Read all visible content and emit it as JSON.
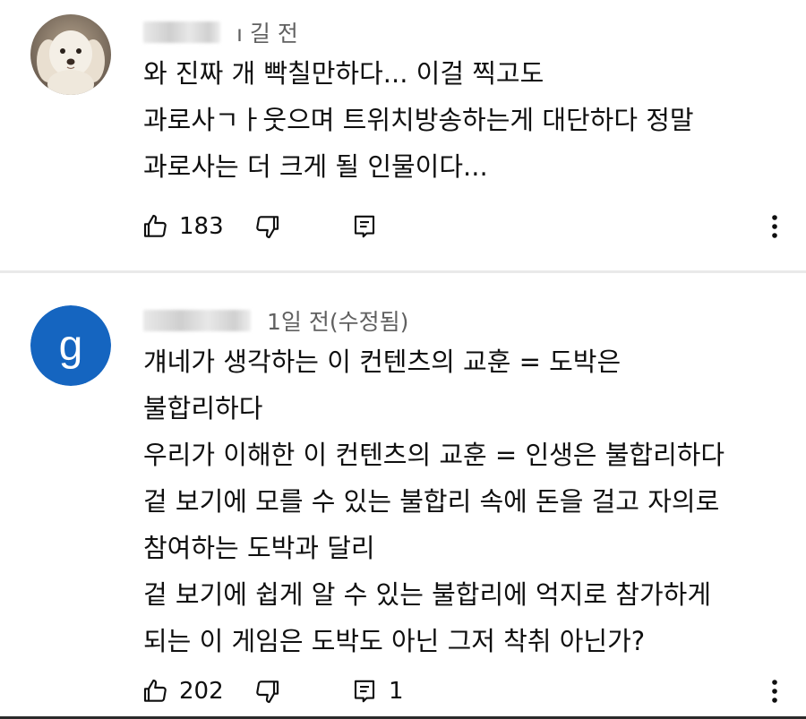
{
  "comments": [
    {
      "avatar": {
        "type": "photo-dog",
        "colors": {
          "bg": "#8a7a6a",
          "fur": "#f1ebe1"
        }
      },
      "author_hidden": true,
      "timestamp": "ı 길 전",
      "lines": [
        "와 진짜 개 빡칠만하다... 이걸 찍고도",
        "과로사ㄱㅏ웃으며 트위치방송하는게 대단하다 정말",
        "과로사는 더 크게 될 인물이다..."
      ],
      "likes": "183",
      "replies": ""
    },
    {
      "avatar": {
        "type": "letter",
        "letter": "g",
        "color": "#1565c0"
      },
      "author_hidden": true,
      "timestamp": "1일 전(수정됨)",
      "lines": [
        "걔네가 생각하는 이 컨텐츠의 교훈 = 도박은",
        "불합리하다",
        "우리가 이해한 이 컨텐츠의 교훈 = 인생은 불합리하다",
        "겉 보기에 모를 수 있는 불합리 속에 돈을 걸고 자의로",
        "참여하는 도박과 달리",
        "겉 보기에 쉽게 알 수 있는 불합리에 억지로 참가하게",
        "되는 이 게임은 도박도 아닌 그저 착취 아닌가?"
      ],
      "likes": "202",
      "replies": "1"
    }
  ],
  "icons": {
    "like": "thumbs-up-icon",
    "dislike": "thumbs-down-icon",
    "reply": "reply-icon",
    "more": "more-vertical-icon"
  }
}
